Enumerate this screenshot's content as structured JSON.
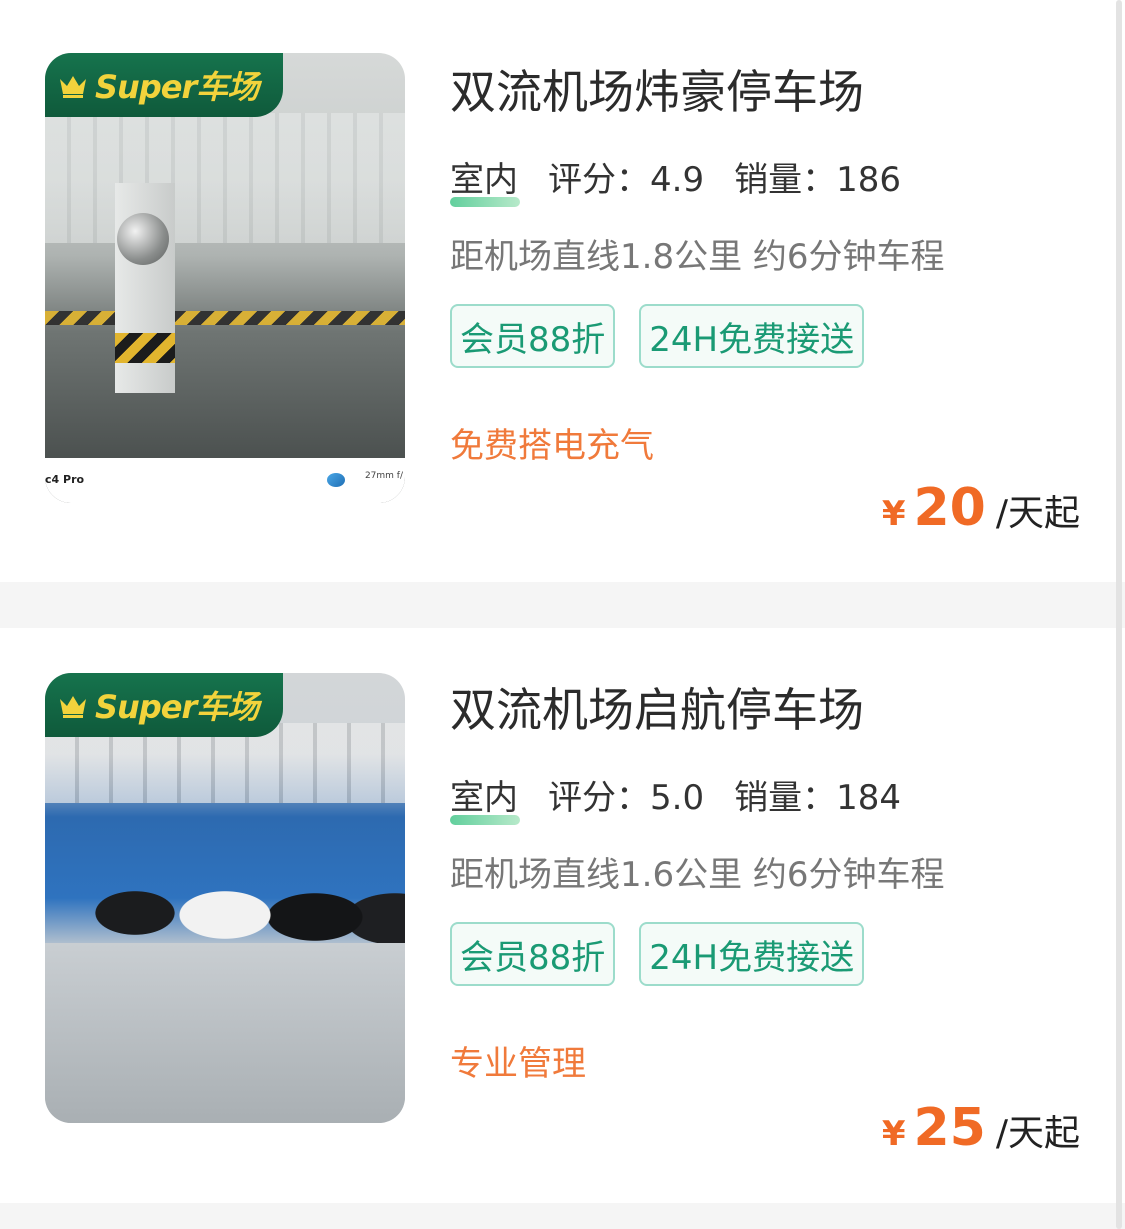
{
  "listings": [
    {
      "badge": "Super车场",
      "title": "双流机场炜豪停车场",
      "type": "室内",
      "rating_label": "评分：",
      "rating": "4.9",
      "sales_label": "销量：",
      "sales": "186",
      "distance": "距机场直线1.8公里 约6分钟车程",
      "tags": [
        "会员88折",
        "24H免费接送"
      ],
      "feature": "免费搭电充气",
      "currency": "¥",
      "price": "20",
      "price_unit": "/天起",
      "photo_caption": "c4 Pro",
      "photo_caption_right": "27mm f/"
    },
    {
      "badge": "Super车场",
      "title": "双流机场启航停车场",
      "type": "室内",
      "rating_label": "评分：",
      "rating": "5.0",
      "sales_label": "销量：",
      "sales": "184",
      "distance": "距机场直线1.6公里 约6分钟车程",
      "tags": [
        "会员88折",
        "24H免费接送"
      ],
      "feature": "专业管理",
      "currency": "¥",
      "price": "25",
      "price_unit": "/天起"
    }
  ],
  "colors": {
    "accent_orange": "#f06a25",
    "badge_green": "#16734d",
    "badge_text": "#f2d33c",
    "tag_green": "#1a9a74"
  },
  "icons": {
    "badge_icon": "crown-icon"
  }
}
